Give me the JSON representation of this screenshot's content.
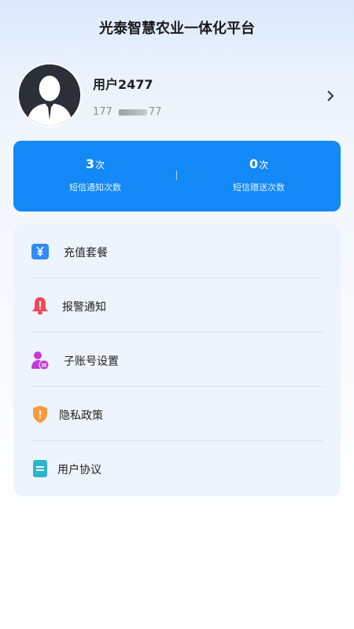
{
  "header": {
    "title": "光泰智慧农业一体化平台"
  },
  "profile": {
    "name": "用户2477",
    "phone_prefix": "177",
    "phone_suffix": "77"
  },
  "stats": [
    {
      "value": "3",
      "unit": "次",
      "label": "短信通知次数"
    },
    {
      "value": "0",
      "unit": "次",
      "label": "短信赠送次数"
    }
  ],
  "menu": [
    {
      "label": "充值套餐",
      "icon": "yuan-icon",
      "color": "#2f8cf6"
    },
    {
      "label": "报警通知",
      "icon": "alarm-bell-icon",
      "color": "#f0485b"
    },
    {
      "label": "子账号设置",
      "icon": "sub-account-icon",
      "color": "#c53ad9"
    },
    {
      "label": "隐私政策",
      "icon": "shield-icon",
      "color": "#f79a3e"
    },
    {
      "label": "用户协议",
      "icon": "document-icon",
      "color": "#2bb5c9"
    }
  ],
  "colors": {
    "accent": "#1389f8",
    "menu_bg": "#eef4fd"
  }
}
